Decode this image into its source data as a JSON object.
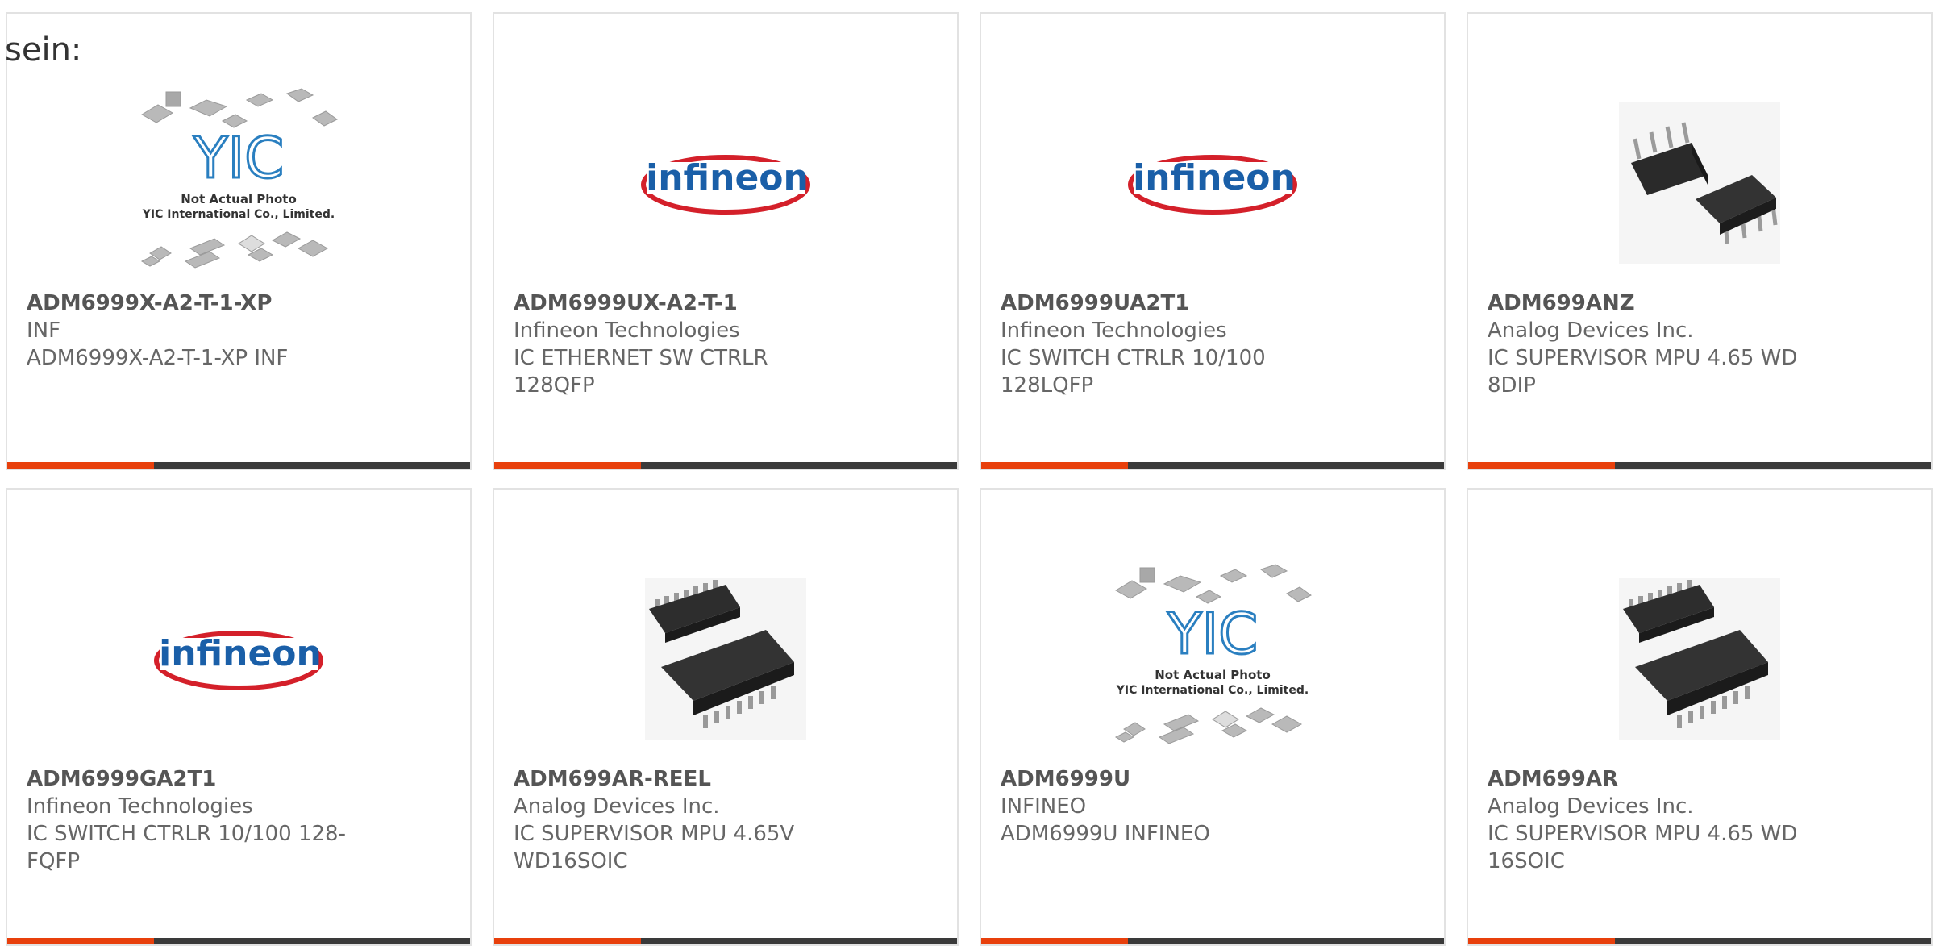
{
  "heading": "sein:",
  "colors": {
    "accent": "#e8400c",
    "bar": "#3a3a3a",
    "infineon_red": "#d4202a",
    "infineon_blue": "#1a5fa8"
  },
  "logo_texts": {
    "infineon": "infineon",
    "yic_mark": "YIC",
    "yic_line1": "Not Actual Photo",
    "yic_line2": "YIC International Co., Limited."
  },
  "products": [
    {
      "part": "ADM6999X-A2-T-1-XP",
      "manufacturer": "INF",
      "description": "ADM6999X-A2-T-1-XP INF",
      "image": "yic-placeholder-icon"
    },
    {
      "part": "ADM6999UX-A2-T-1",
      "manufacturer": "Infineon Technologies",
      "description": "IC ETHERNET SW CTRLR 128QFP",
      "image": "infineon-logo-icon"
    },
    {
      "part": "ADM6999UA2T1",
      "manufacturer": "Infineon Technologies",
      "description": "IC SWITCH CTRLR 10/100 128LQFP",
      "image": "infineon-logo-icon"
    },
    {
      "part": "ADM699ANZ",
      "manufacturer": "Analog Devices Inc.",
      "description": "IC SUPERVISOR MPU 4.65 WD 8DIP",
      "image": "dip-chip-icon"
    },
    {
      "part": "ADM6999GA2T1",
      "manufacturer": "Infineon Technologies",
      "description": "IC SWITCH CTRLR 10/100 128-FQFP",
      "image": "infineon-logo-icon"
    },
    {
      "part": "ADM699AR-REEL",
      "manufacturer": "Analog Devices Inc.",
      "description": "IC SUPERVISOR MPU 4.65V WD16SOIC",
      "image": "soic-chip-icon"
    },
    {
      "part": "ADM6999U",
      "manufacturer": "INFINEO",
      "description": "ADM6999U INFINEO",
      "image": "yic-placeholder-icon"
    },
    {
      "part": "ADM699AR",
      "manufacturer": "Analog Devices Inc.",
      "description": "IC SUPERVISOR MPU 4.65 WD 16SOIC",
      "image": "soic-chip-icon"
    }
  ]
}
